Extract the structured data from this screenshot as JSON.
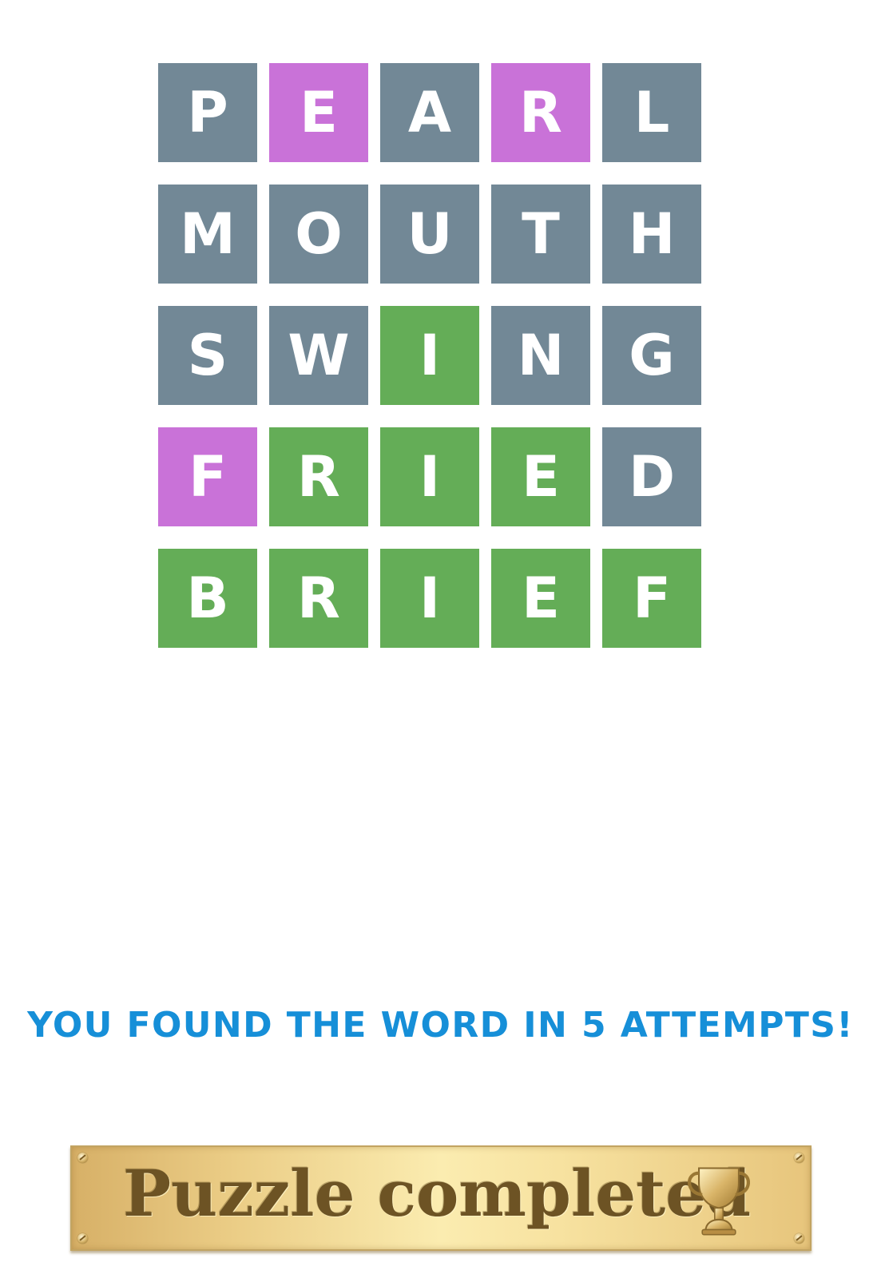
{
  "board": {
    "rows": [
      {
        "tiles": [
          {
            "letter": "P",
            "state": "absent"
          },
          {
            "letter": "E",
            "state": "present"
          },
          {
            "letter": "A",
            "state": "absent"
          },
          {
            "letter": "R",
            "state": "present"
          },
          {
            "letter": "L",
            "state": "absent"
          }
        ]
      },
      {
        "tiles": [
          {
            "letter": "M",
            "state": "absent"
          },
          {
            "letter": "O",
            "state": "absent"
          },
          {
            "letter": "U",
            "state": "absent"
          },
          {
            "letter": "T",
            "state": "absent"
          },
          {
            "letter": "H",
            "state": "absent"
          }
        ]
      },
      {
        "tiles": [
          {
            "letter": "S",
            "state": "absent"
          },
          {
            "letter": "W",
            "state": "absent"
          },
          {
            "letter": "I",
            "state": "correct"
          },
          {
            "letter": "N",
            "state": "absent"
          },
          {
            "letter": "G",
            "state": "absent"
          }
        ]
      },
      {
        "tiles": [
          {
            "letter": "F",
            "state": "present"
          },
          {
            "letter": "R",
            "state": "correct"
          },
          {
            "letter": "I",
            "state": "correct"
          },
          {
            "letter": "E",
            "state": "correct"
          },
          {
            "letter": "D",
            "state": "absent"
          }
        ]
      },
      {
        "tiles": [
          {
            "letter": "B",
            "state": "correct"
          },
          {
            "letter": "R",
            "state": "correct"
          },
          {
            "letter": "I",
            "state": "correct"
          },
          {
            "letter": "E",
            "state": "correct"
          },
          {
            "letter": "F",
            "state": "correct"
          }
        ]
      }
    ]
  },
  "result": {
    "message": "YOU FOUND THE WORD IN 5 ATTEMPTS!"
  },
  "banner": {
    "label": "Puzzle completed",
    "icon": "trophy-icon"
  },
  "colors": {
    "absent": "#728896",
    "present": "#c972d8",
    "correct": "#64ad57",
    "message": "#168fd8",
    "banner_text": "#6d5324"
  }
}
